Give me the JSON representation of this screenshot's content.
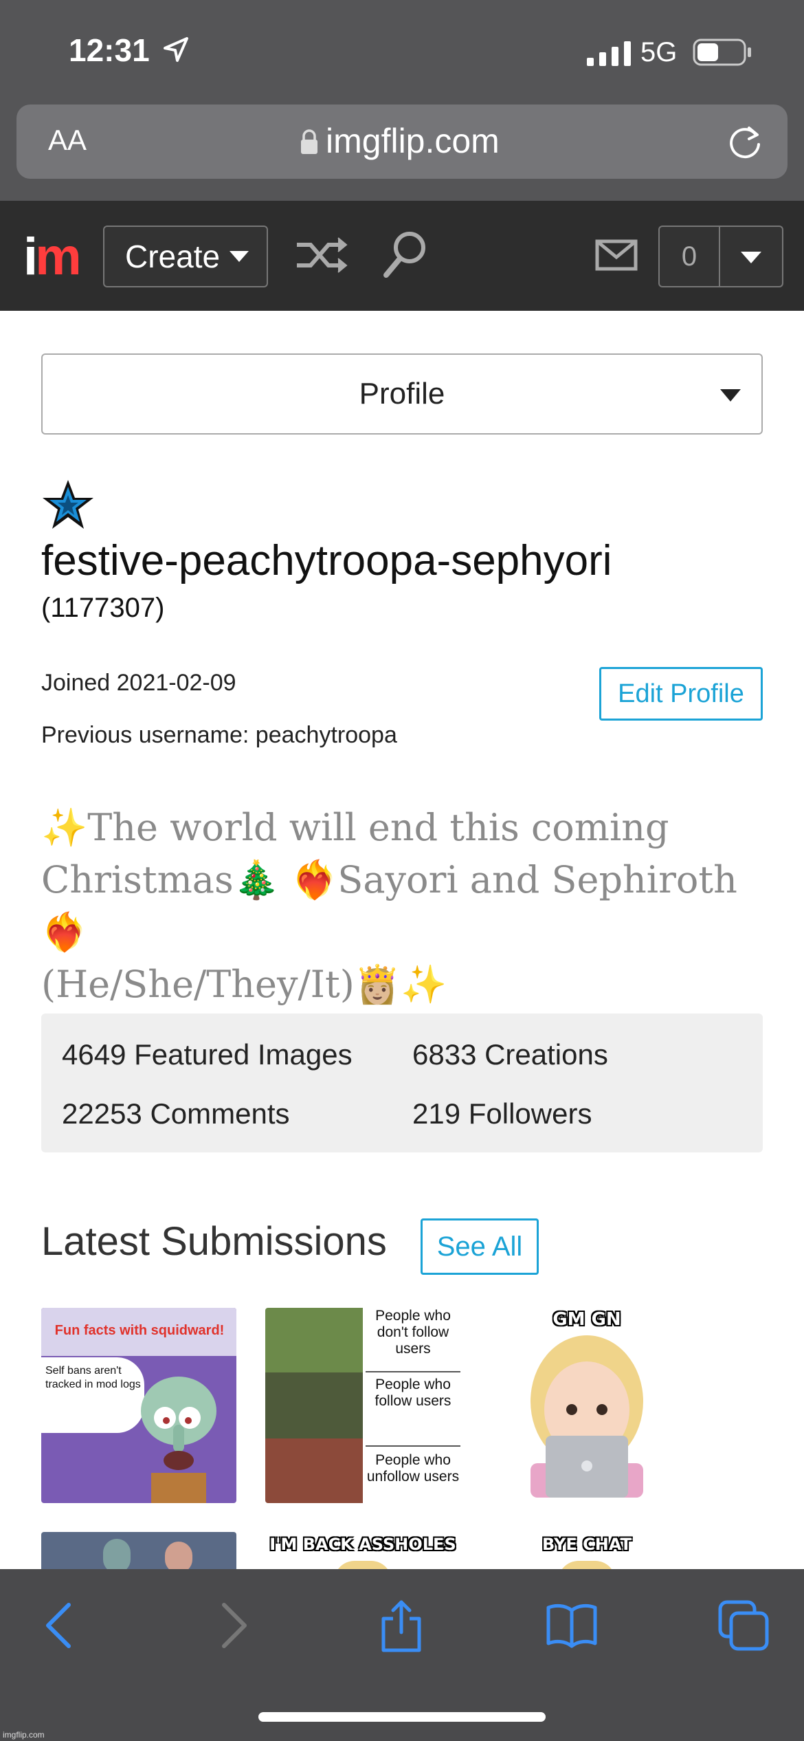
{
  "status_bar": {
    "time": "12:31",
    "network": "5G"
  },
  "browser": {
    "text_size_label": "AA",
    "url": "imgflip.com"
  },
  "nav": {
    "logo_i": "i",
    "logo_m": "m",
    "create_label": "Create",
    "notif_count": "0"
  },
  "profile_select": {
    "value": "Profile"
  },
  "profile": {
    "username": "festive-peachytroopa-sephyori",
    "user_id": "(1177307)",
    "joined": "Joined 2021-02-09",
    "previous_username": "Previous username: peachytroopa",
    "edit_label": "Edit Profile",
    "bio_line1": "✨The world will end this coming",
    "bio_line2": "Christmas🎄 ❤️‍🔥Sayori and Sephiroth❤️‍🔥",
    "bio_line3": "(He/She/They/It)👸🏼✨"
  },
  "stats": {
    "featured": "4649 Featured Images",
    "creations": "6833 Creations",
    "comments": "22253 Comments",
    "followers": "219 Followers"
  },
  "latest": {
    "title": "Latest Submissions",
    "see_all": "See All",
    "thumbs": [
      {
        "title": "Fun facts with squidward!",
        "text": "Self bans aren't tracked in mod logs"
      },
      {
        "panel1": "People who don't follow users",
        "panel2": "People who follow users",
        "panel3": "People who unfollow users"
      },
      {
        "caption": "GM GN"
      },
      {
        "caption": ""
      },
      {
        "caption": "I'M BACK ASSHOLES"
      },
      {
        "caption": "BYE CHAT"
      }
    ]
  },
  "watermark": "imgflip.com",
  "colors": {
    "accent": "#1ba3d6",
    "logo_red": "#ff3d3d",
    "nav_bg": "#2d2d2d",
    "toolbar_blue": "#3a8df5"
  }
}
